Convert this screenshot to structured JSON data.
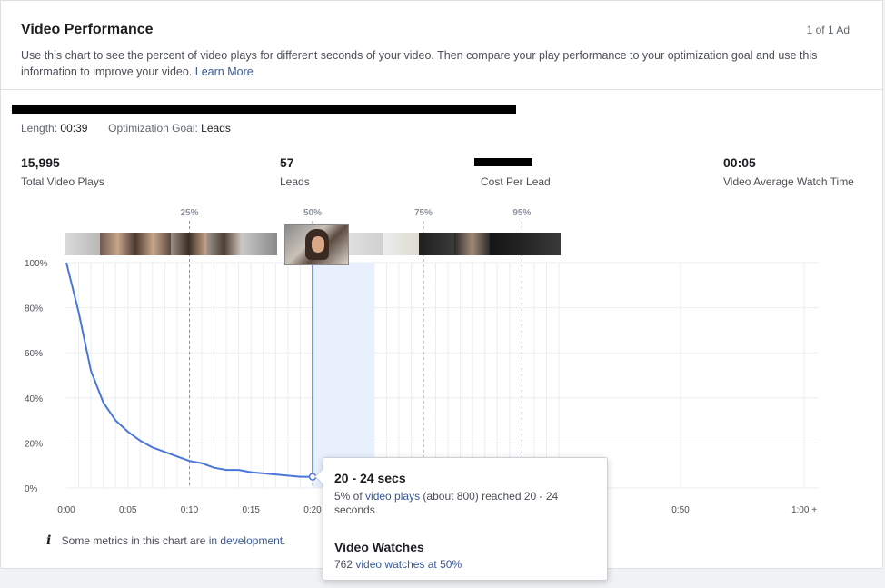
{
  "header": {
    "title": "Video Performance",
    "count": "1 of 1 Ad",
    "description": "Use this chart to see the percent of video plays for different seconds of your video. Then compare your play performance to your optimization goal and use this information to improve your video.",
    "learn_more": "Learn More"
  },
  "video_meta": {
    "length_label": "Length:",
    "length_value": "00:39",
    "goal_label": "Optimization Goal:",
    "goal_value": "Leads"
  },
  "stats": [
    {
      "value": "15,995",
      "label": "Total Video Plays"
    },
    {
      "value": "57",
      "label": "Leads"
    },
    {
      "value": "",
      "label": "Cost Per Lead"
    },
    {
      "value": "00:05",
      "label": "Video Average Watch Time"
    }
  ],
  "chart_data": {
    "type": "line",
    "x": [
      0,
      1,
      2,
      3,
      4,
      5,
      6,
      7,
      8,
      9,
      10,
      11,
      12,
      13,
      14,
      15,
      16,
      17,
      18,
      19,
      20
    ],
    "values": [
      100,
      78,
      52,
      38,
      30,
      25,
      21,
      18,
      16,
      14,
      12,
      11,
      9,
      8,
      8,
      7,
      6.5,
      6,
      5.5,
      5,
      5
    ],
    "x_ticks": [
      "0:00",
      "0:05",
      "0:10",
      "0:15",
      "0:20",
      "0:50",
      "1:00 +"
    ],
    "y_ticks": [
      "100%",
      "80%",
      "60%",
      "40%",
      "20%",
      "0%"
    ],
    "ylim": [
      0,
      100
    ],
    "xlim": [
      0,
      60
    ],
    "markers": [
      {
        "label": "25%",
        "x": 10
      },
      {
        "label": "50%",
        "x": 20
      },
      {
        "label": "75%",
        "x": 29
      },
      {
        "label": "95%",
        "x": 37
      }
    ],
    "highlight": {
      "x_start": 20,
      "x_end": 25,
      "selected_x": 20,
      "selected_y": 5
    },
    "line_color": "#4a76d8",
    "highlight_color": "#e8f0fd",
    "grid": true
  },
  "tooltip": {
    "title": "20 - 24 secs",
    "line1_prefix": "5% of",
    "line1_link": "video plays",
    "line1_suffix": "(about 800) reached 20 - 24 seconds.",
    "section2_title": "Video Watches",
    "line2_prefix": "762",
    "line2_link": "video watches at 50%"
  },
  "footer_note": {
    "icon": "info-icon",
    "text": "Some metrics in this chart are",
    "link": "in development",
    "end": "."
  }
}
